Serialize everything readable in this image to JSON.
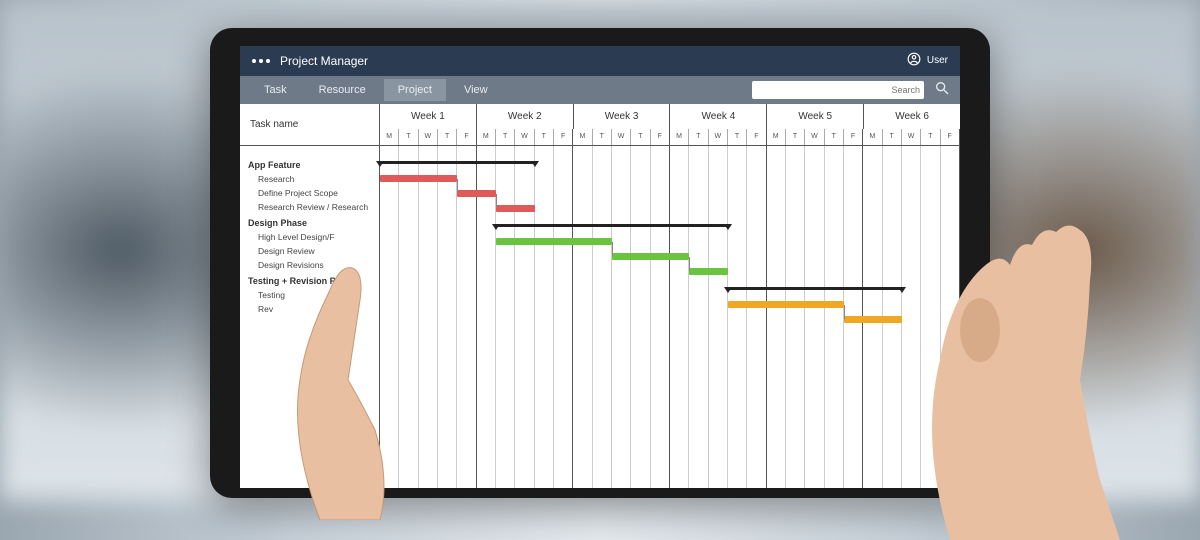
{
  "app": {
    "title": "Project Manager"
  },
  "user": {
    "label": "User"
  },
  "tabs": [
    "Task",
    "Resource",
    "Project",
    "View"
  ],
  "active_tab": "Project",
  "search": {
    "placeholder": "Search"
  },
  "columns": {
    "task_name": "Task name"
  },
  "weeks": [
    "Week 1",
    "Week 2",
    "Week 3",
    "Week 4",
    "Week 5",
    "Week 6"
  ],
  "day_labels": [
    "M",
    "T",
    "W",
    "T",
    "F"
  ],
  "groups": [
    {
      "name": "App Feature",
      "tasks": [
        "Research",
        "Define Project Scope",
        "Research Review / Research"
      ]
    },
    {
      "name": "Design Phase",
      "tasks": [
        "High Level Design/F",
        "Design Review",
        "Design Revisions"
      ]
    },
    {
      "name": "Testing + Revision Phase",
      "tasks": [
        "Testing",
        "Rev"
      ]
    }
  ],
  "chart_data": {
    "type": "gantt",
    "title": "Project Manager",
    "x_unit": "day",
    "x_range": [
      1,
      30
    ],
    "weeks": 6,
    "days_per_week": 5,
    "groups": [
      {
        "name": "App Feature",
        "summary": {
          "start": 1,
          "end": 9
        },
        "tasks": [
          {
            "name": "Research",
            "start": 1,
            "end": 5,
            "color": "#e05a5a"
          },
          {
            "name": "Define Project Scope",
            "start": 5,
            "end": 7,
            "color": "#e05a5a"
          },
          {
            "name": "Research Review / Research",
            "start": 7,
            "end": 9,
            "color": "#e05a5a"
          }
        ]
      },
      {
        "name": "Design Phase",
        "summary": {
          "start": 7,
          "end": 19
        },
        "tasks": [
          {
            "name": "High Level Design/F",
            "start": 7,
            "end": 13,
            "color": "#6bc43f"
          },
          {
            "name": "Design Review",
            "start": 13,
            "end": 17,
            "color": "#6bc43f"
          },
          {
            "name": "Design Revisions",
            "start": 17,
            "end": 19,
            "color": "#6bc43f"
          }
        ]
      },
      {
        "name": "Testing + Revision Phase",
        "summary": {
          "start": 19,
          "end": 28
        },
        "tasks": [
          {
            "name": "Testing",
            "start": 19,
            "end": 25,
            "color": "#f0a824"
          },
          {
            "name": "Rev",
            "start": 25,
            "end": 28,
            "color": "#f0a824"
          }
        ]
      }
    ]
  }
}
